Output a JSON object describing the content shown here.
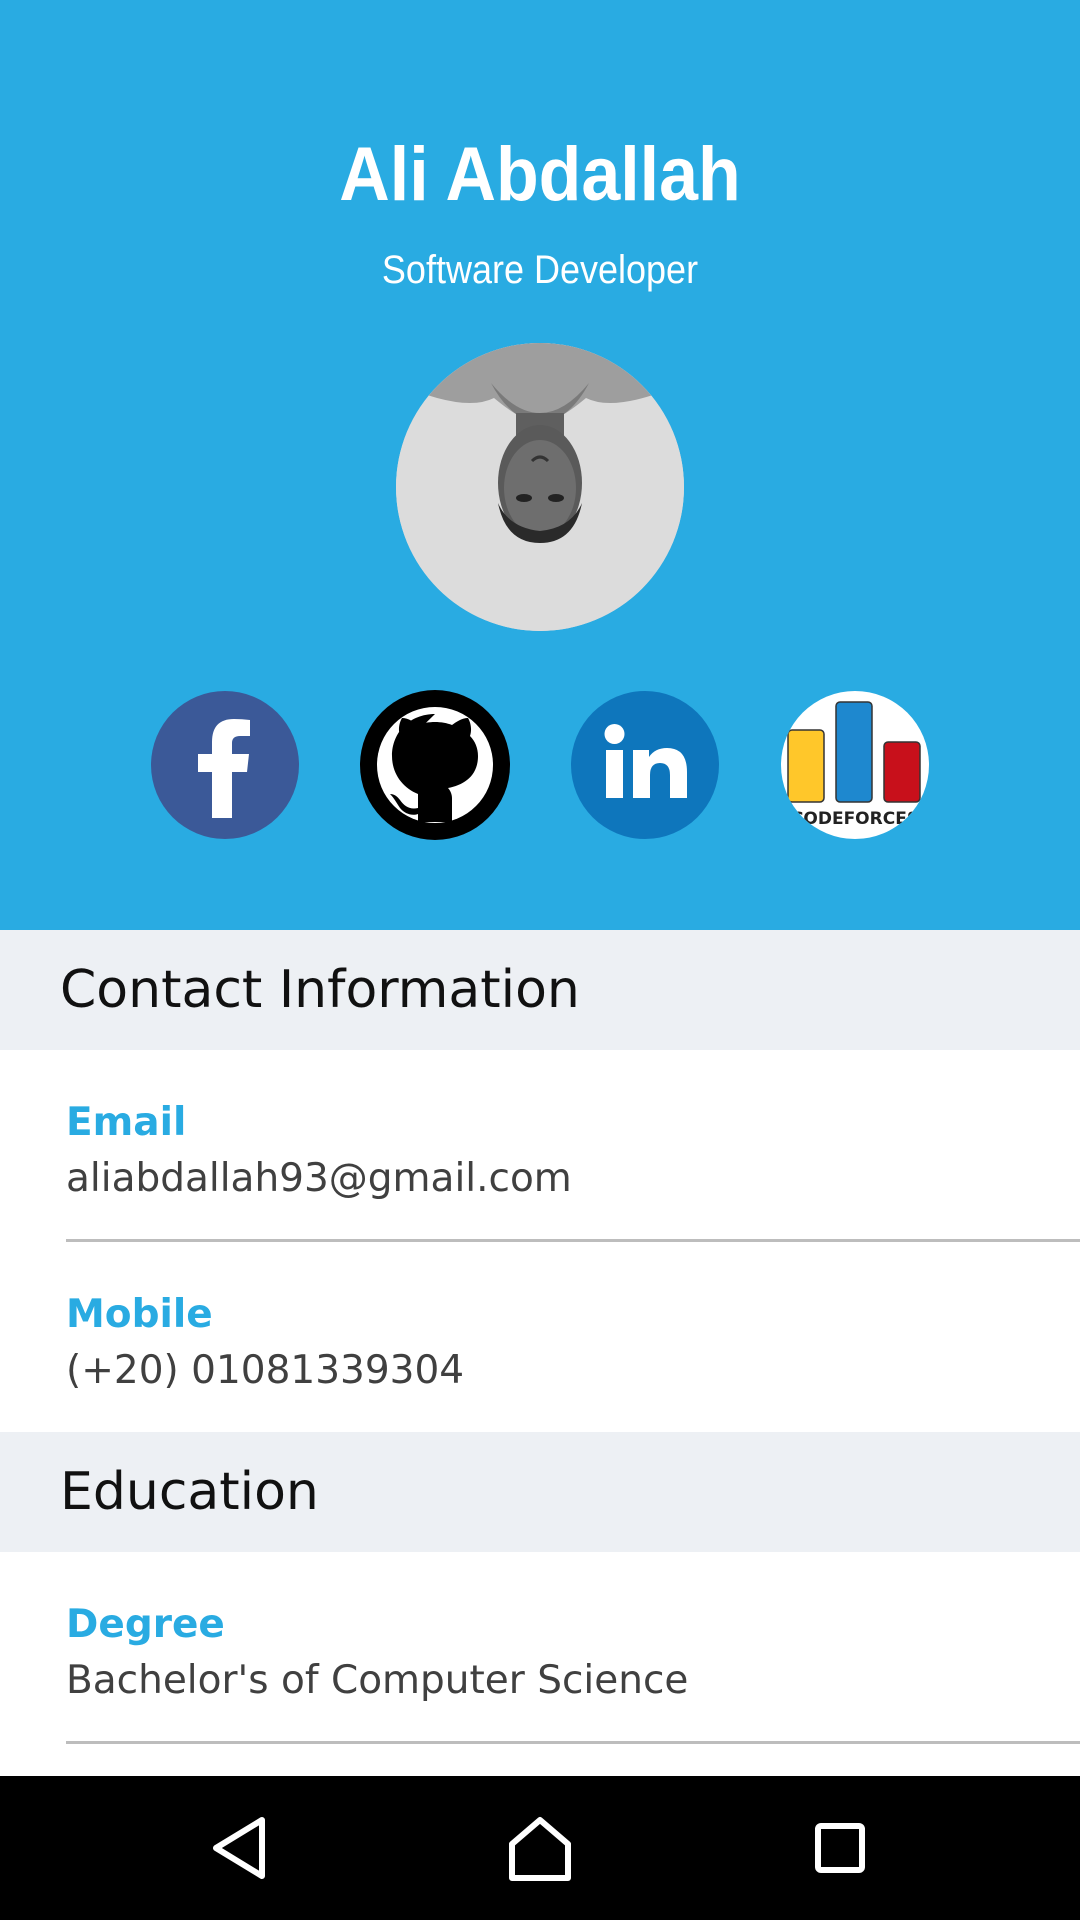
{
  "profile": {
    "name": "Ali Abdallah",
    "role": "Software Developer"
  },
  "social": [
    {
      "icon": "facebook-icon",
      "color": "#3b5998"
    },
    {
      "icon": "github-icon",
      "color": "#000000"
    },
    {
      "icon": "linkedin-icon",
      "color": "#0e76bc"
    },
    {
      "icon": "codeforces-icon",
      "text": "CODEFORCES"
    }
  ],
  "contact": {
    "title": "Contact Information",
    "email_label": "Email",
    "email_value": "aliabdallah93@gmail.com",
    "mobile_label": "Mobile",
    "mobile_value": "(+20) 01081339304"
  },
  "education": {
    "title": "Education",
    "degree_label": "Degree",
    "degree_value": "Bachelor's of Computer Science"
  },
  "colors": {
    "accent": "#29abe2",
    "section_bg": "#edf0f4"
  },
  "navbar": {
    "back_icon": "back-icon",
    "home_icon": "home-icon",
    "recent_icon": "recent-apps-icon"
  }
}
